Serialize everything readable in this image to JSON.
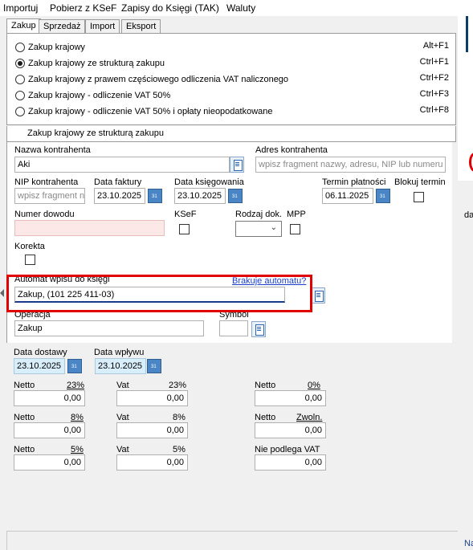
{
  "menu": [
    "Importuj",
    "Pobierz z KSeF",
    "Zapisy do Księgi (TAK)",
    "Waluty"
  ],
  "tabs": [
    "Zakup",
    "Sprzedaż",
    "Import",
    "Eksport"
  ],
  "options": [
    {
      "label": "Zakup krajowy",
      "key": "Alt+F1",
      "selected": false
    },
    {
      "label": "Zakup krajowy ze strukturą zakupu",
      "key": "Ctrl+F1",
      "selected": true
    },
    {
      "label": "Zakup krajowy z prawem częściowego odliczenia VAT naliczonego",
      "key": "Ctrl+F2",
      "selected": false
    },
    {
      "label": "Zakup krajowy - odliczenie VAT 50%",
      "key": "Ctrl+F3",
      "selected": false
    },
    {
      "label": "Zakup krajowy - odliczenie VAT 50% i opłaty nieopodatkowane",
      "key": "Ctrl+F8",
      "selected": false
    }
  ],
  "subtitle": "Zakup krajowy ze strukturą zakupu",
  "form": {
    "nazwa_label": "Nazwa kontrahenta",
    "nazwa_value": "Aki",
    "adres_label": "Adres kontrahenta",
    "adres_placeholder": "wpisz fragment nazwy, adresu, NIP lub numeru k",
    "nip_label": "NIP kontrahenta",
    "nip_placeholder": "wpisz fragment n",
    "data_faktury_label": "Data faktury",
    "data_faktury_value": "23.10.2025",
    "data_ksiegowania_label": "Data księgowania",
    "data_ksiegowania_value": "23.10.2025",
    "termin_label": "Termin płatności",
    "termin_value": "06.11.2025",
    "blokuj_label": "Blokuj termin",
    "numer_label": "Numer dowodu",
    "ksef_label": "KSeF",
    "rodzaj_label": "Rodzaj dok.",
    "mpp_label": "MPP",
    "korekta_label": "Korekta",
    "automat_label": "Automat wpisu do księgi",
    "brakuje_link": "Brakuje automatu?",
    "automat_value": "Zakup, (101 225 411-03)",
    "operacja_label": "Operacja",
    "operacja_value": "Zakup",
    "symbol_label": "Symbol"
  },
  "lower": {
    "data_dostawy_label": "Data dostawy",
    "data_dostawy_value": "23.10.2025",
    "data_wplywu_label": "Data wpływu",
    "data_wplywu_value": "23.10.2025",
    "netto": "Netto",
    "vat": "Vat",
    "r23": "23%",
    "r8": "8%",
    "r5": "5%",
    "r0": "0%",
    "zwoln": "Zwoln.",
    "nie_podlega": "Nie podlega VAT",
    "zero": "0,00"
  },
  "right_strip": {
    "da": "da",
    "na": "Na"
  }
}
